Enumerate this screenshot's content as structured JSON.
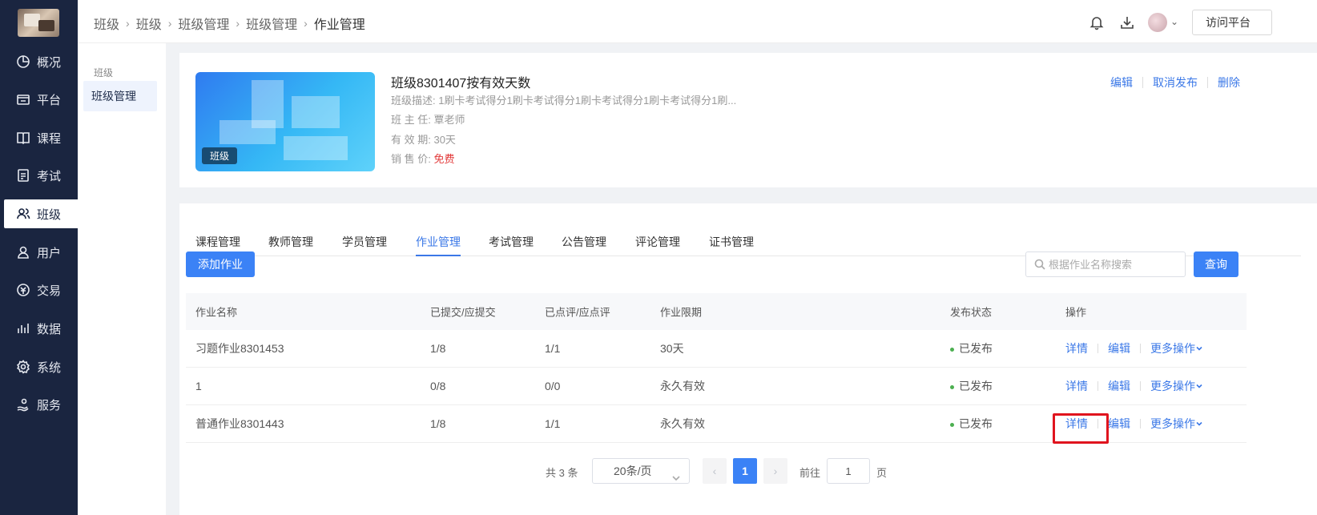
{
  "nav": {
    "items": [
      {
        "label": "概况",
        "icon": "dashboard-icon"
      },
      {
        "label": "平台",
        "icon": "platform-icon"
      },
      {
        "label": "课程",
        "icon": "book-icon"
      },
      {
        "label": "考试",
        "icon": "exam-icon"
      },
      {
        "label": "班级",
        "icon": "class-icon",
        "active": true
      },
      {
        "label": "用户",
        "icon": "user-icon"
      },
      {
        "label": "交易",
        "icon": "trade-icon"
      },
      {
        "label": "数据",
        "icon": "chart-icon"
      },
      {
        "label": "系统",
        "icon": "gear-icon"
      },
      {
        "label": "服务",
        "icon": "service-icon"
      }
    ]
  },
  "header": {
    "breadcrumb": [
      "班级",
      "班级",
      "班级管理",
      "班级管理",
      "作业管理"
    ],
    "visit_label": "访问平台"
  },
  "submenu": {
    "group": "班级",
    "item": "班级管理"
  },
  "info": {
    "cover_badge": "班级",
    "title": "班级8301407按有效天数",
    "desc_label": "班级描述:",
    "desc": "1刷卡考试得分1刷卡考试得分1刷卡考试得分1刷卡考试得分1刷...",
    "teacher_label": "班 主 任:",
    "teacher": "覃老师",
    "valid_label": "有 效 期:",
    "valid": "30天",
    "price_label": "销 售 价:",
    "price": "免费",
    "actions": {
      "edit": "编辑",
      "unpublish": "取消发布",
      "delete": "删除"
    }
  },
  "tabs": [
    "课程管理",
    "教师管理",
    "学员管理",
    "作业管理",
    "考试管理",
    "公告管理",
    "评论管理",
    "证书管理"
  ],
  "active_tab": "作业管理",
  "toolbar": {
    "add_label": "添加作业",
    "search_placeholder": "根据作业名称搜索",
    "query_label": "查询"
  },
  "table": {
    "headers": [
      "作业名称",
      "已提交/应提交",
      "已点评/应点评",
      "作业限期",
      "发布状态",
      "操作"
    ],
    "rows": [
      {
        "name": "习题作业8301453",
        "submitted": "1/8",
        "reviewed": "1/1",
        "deadline": "30天",
        "status": "已发布"
      },
      {
        "name": "1",
        "submitted": "0/8",
        "reviewed": "0/0",
        "deadline": "永久有效",
        "status": "已发布"
      },
      {
        "name": "普通作业8301443",
        "submitted": "1/8",
        "reviewed": "1/1",
        "deadline": "永久有效",
        "status": "已发布"
      }
    ],
    "ops": {
      "detail": "详情",
      "edit": "编辑",
      "more": "更多操作"
    }
  },
  "pagination": {
    "total": "共 3 条",
    "page_size": "20条/页",
    "prev": "‹",
    "current": "1",
    "next": "›",
    "goto_label": "前往",
    "goto_value": "1",
    "page_unit": "页"
  },
  "colors": {
    "sidebar_bg": "#1a2540",
    "accent": "#3b82f6",
    "link": "#3b78e7",
    "danger": "#e23a3a",
    "status_dot": "#4caf50",
    "highlight": "#e0141e"
  }
}
